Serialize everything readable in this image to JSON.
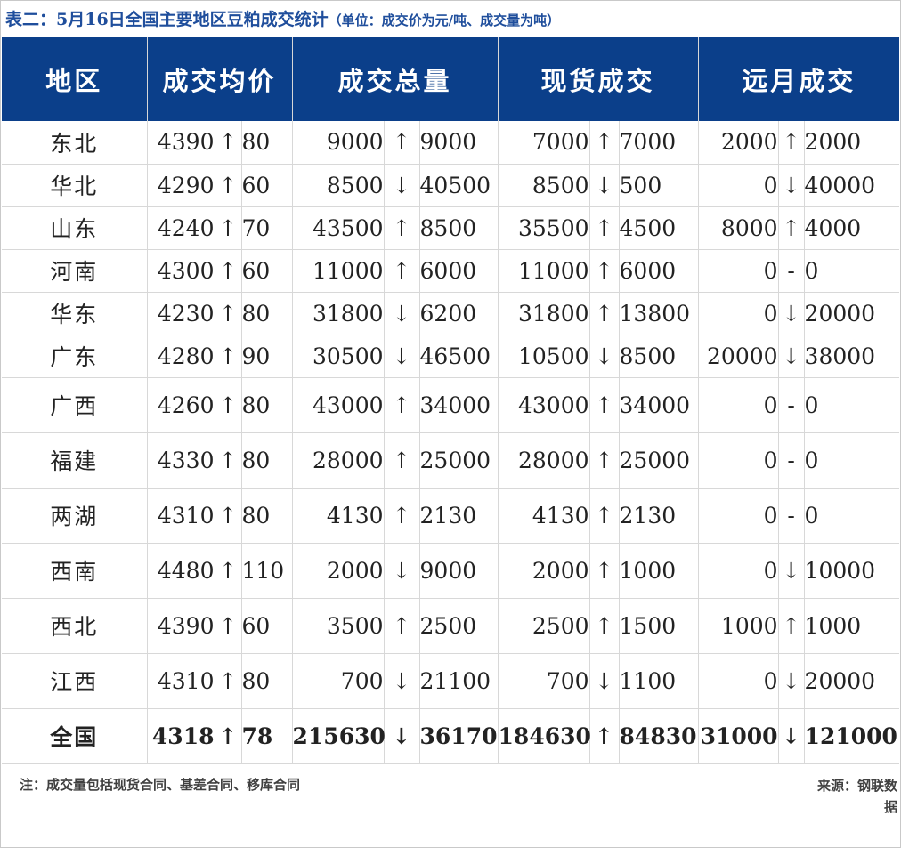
{
  "caption": {
    "title": "表二：5月16日全国主要地区豆粕成交统计",
    "unit_note": "（单位：成交价为元/吨、成交量为吨）"
  },
  "headers": [
    "地区",
    "成交均价",
    "成交总量",
    "现货成交",
    "远月成交"
  ],
  "rows": [
    {
      "region": "东北",
      "price": "4390",
      "price_dir": "↑",
      "price_chg": "80",
      "total": "9000",
      "total_dir": "↑",
      "total_chg": "9000",
      "spot": "7000",
      "spot_dir": "↑",
      "spot_chg": "7000",
      "fwd": "2000",
      "fwd_dir": "↑",
      "fwd_chg": "2000"
    },
    {
      "region": "华北",
      "price": "4290",
      "price_dir": "↑",
      "price_chg": "60",
      "total": "8500",
      "total_dir": "↓",
      "total_chg": "40500",
      "spot": "8500",
      "spot_dir": "↓",
      "spot_chg": "500",
      "fwd": "0",
      "fwd_dir": "↓",
      "fwd_chg": "40000"
    },
    {
      "region": "山东",
      "price": "4240",
      "price_dir": "↑",
      "price_chg": "70",
      "total": "43500",
      "total_dir": "↑",
      "total_chg": "8500",
      "spot": "35500",
      "spot_dir": "↑",
      "spot_chg": "4500",
      "fwd": "8000",
      "fwd_dir": "↑",
      "fwd_chg": "4000"
    },
    {
      "region": "河南",
      "price": "4300",
      "price_dir": "↑",
      "price_chg": "60",
      "total": "11000",
      "total_dir": "↑",
      "total_chg": "6000",
      "spot": "11000",
      "spot_dir": "↑",
      "spot_chg": "6000",
      "fwd": "0",
      "fwd_dir": "-",
      "fwd_chg": "0"
    },
    {
      "region": "华东",
      "price": "4230",
      "price_dir": "↑",
      "price_chg": "80",
      "total": "31800",
      "total_dir": "↓",
      "total_chg": "6200",
      "spot": "31800",
      "spot_dir": "↑",
      "spot_chg": "13800",
      "fwd": "0",
      "fwd_dir": "↓",
      "fwd_chg": "20000"
    },
    {
      "region": "广东",
      "price": "4280",
      "price_dir": "↑",
      "price_chg": "90",
      "total": "30500",
      "total_dir": "↓",
      "total_chg": "46500",
      "spot": "10500",
      "spot_dir": "↓",
      "spot_chg": "8500",
      "fwd": "20000",
      "fwd_dir": "↓",
      "fwd_chg": "38000"
    },
    {
      "region": "广西",
      "price": "4260",
      "price_dir": "↑",
      "price_chg": "80",
      "total": "43000",
      "total_dir": "↑",
      "total_chg": "34000",
      "spot": "43000",
      "spot_dir": "↑",
      "spot_chg": "34000",
      "fwd": "0",
      "fwd_dir": "-",
      "fwd_chg": "0"
    },
    {
      "region": "福建",
      "price": "4330",
      "price_dir": "↑",
      "price_chg": "80",
      "total": "28000",
      "total_dir": "↑",
      "total_chg": "25000",
      "spot": "28000",
      "spot_dir": "↑",
      "spot_chg": "25000",
      "fwd": "0",
      "fwd_dir": "-",
      "fwd_chg": "0"
    },
    {
      "region": "两湖",
      "price": "4310",
      "price_dir": "↑",
      "price_chg": "80",
      "total": "4130",
      "total_dir": "↑",
      "total_chg": "2130",
      "spot": "4130",
      "spot_dir": "↑",
      "spot_chg": "2130",
      "fwd": "0",
      "fwd_dir": "-",
      "fwd_chg": "0"
    },
    {
      "region": "西南",
      "price": "4480",
      "price_dir": "↑",
      "price_chg": "110",
      "total": "2000",
      "total_dir": "↓",
      "total_chg": "9000",
      "spot": "2000",
      "spot_dir": "↑",
      "spot_chg": "1000",
      "fwd": "0",
      "fwd_dir": "↓",
      "fwd_chg": "10000"
    },
    {
      "region": "西北",
      "price": "4390",
      "price_dir": "↑",
      "price_chg": "60",
      "total": "3500",
      "total_dir": "↑",
      "total_chg": "2500",
      "spot": "2500",
      "spot_dir": "↑",
      "spot_chg": "1500",
      "fwd": "1000",
      "fwd_dir": "↑",
      "fwd_chg": "1000"
    },
    {
      "region": "江西",
      "price": "4310",
      "price_dir": "↑",
      "price_chg": "80",
      "total": "700",
      "total_dir": "↓",
      "total_chg": "21100",
      "spot": "700",
      "spot_dir": "↓",
      "spot_chg": "1100",
      "fwd": "0",
      "fwd_dir": "↓",
      "fwd_chg": "20000"
    }
  ],
  "total_row": {
    "region": "全国",
    "price": "4318",
    "price_dir": "↑",
    "price_chg": "78",
    "total": "215630",
    "total_dir": "↓",
    "total_chg": "36170",
    "spot": "184630",
    "spot_dir": "↑",
    "spot_chg": "84830",
    "fwd": "31000",
    "fwd_dir": "↓",
    "fwd_chg": "121000"
  },
  "colors": {
    "header_bg": "#0b3f8a",
    "up": "#c00000",
    "down": "#548235",
    "caption": "#1f4e9c"
  },
  "footer": {
    "note": "注：成交量包括现货合同、基差合同、移库合同",
    "source": "来源：钢联数据"
  }
}
